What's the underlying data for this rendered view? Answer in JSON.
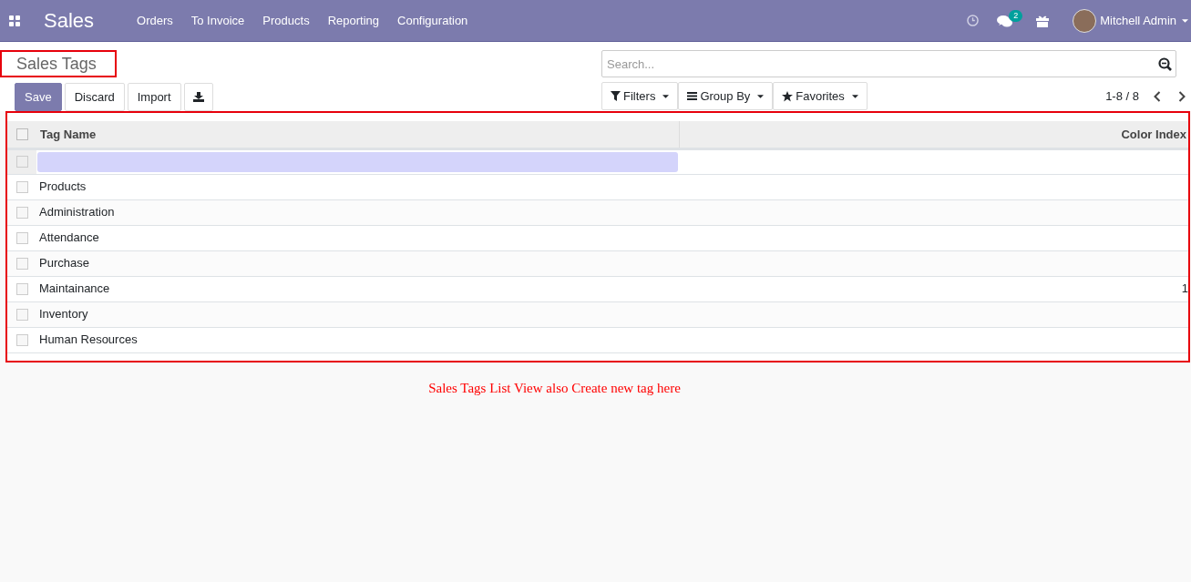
{
  "navbar": {
    "app_title": "Sales",
    "menu": [
      "Orders",
      "To Invoice",
      "Products",
      "Reporting",
      "Configuration"
    ],
    "chat_badge": "2",
    "user": "Mitchell Admin"
  },
  "page_title": "Sales Tags",
  "buttons": [
    {
      "label": "Save",
      "kind": "primary"
    },
    {
      "label": "Discard",
      "kind": "secondary"
    },
    {
      "label": "Import",
      "kind": "secondary"
    }
  ],
  "search": {
    "placeholder": "Search..."
  },
  "search_buttons": [
    "Filters",
    "Group By",
    "Favorites"
  ],
  "pager": "1-8 / 8",
  "table": {
    "columns": [
      "Tag Name",
      "Color Index"
    ],
    "select_all_checked": false,
    "new_row": {
      "focused": true,
      "checked": false
    },
    "rows": [
      {
        "tag_name": "Products",
        "checked": false
      },
      {
        "tag_name": "Administration",
        "checked": false
      },
      {
        "tag_name": "Attendance",
        "checked": false
      },
      {
        "tag_name": "Purchase",
        "checked": false
      },
      {
        "tag_name": "Maintainance",
        "checked": false,
        "color_index": "1"
      },
      {
        "tag_name": "Inventory",
        "checked": false
      },
      {
        "tag_name": "Human Resources",
        "checked": false
      }
    ]
  },
  "annotation": "Sales Tags List View also Create new tag here"
}
